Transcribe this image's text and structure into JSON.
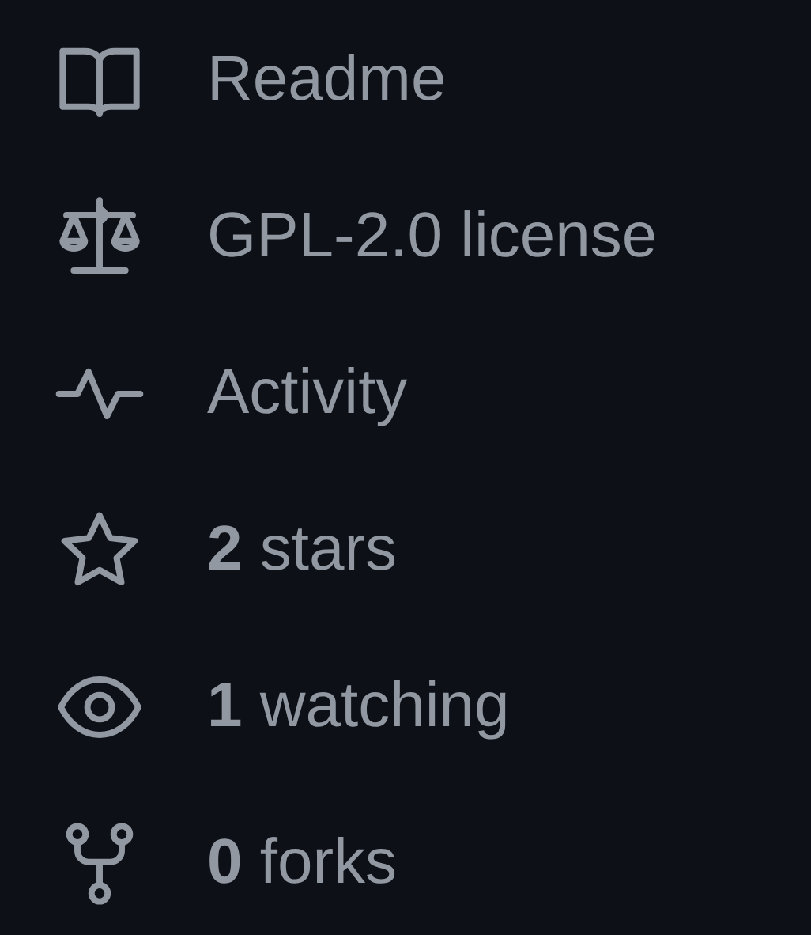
{
  "links": [
    {
      "kind": "book",
      "label": "Readme"
    },
    {
      "kind": "scale",
      "label": "GPL-2.0 license"
    },
    {
      "kind": "pulse",
      "label": "Activity"
    },
    {
      "kind": "star",
      "label": "**2** stars"
    },
    {
      "kind": "eye",
      "label": "**1** watching"
    },
    {
      "kind": "fork",
      "label": "**0** forks"
    }
  ]
}
